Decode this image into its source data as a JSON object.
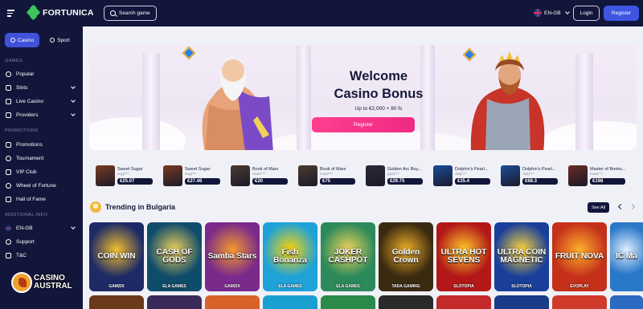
{
  "brand": {
    "name": "FORTUNICA"
  },
  "header": {
    "search_label": "Search game",
    "language": "EN-GB",
    "login": "Login",
    "register": "Register"
  },
  "sidebar": {
    "modes": [
      {
        "label": "Casino"
      },
      {
        "label": "Sport"
      }
    ],
    "sections": {
      "games": "GAMES",
      "promotions": "PROMOTIONS",
      "additional": "ADDITIONAL INFO"
    },
    "games": [
      {
        "label": "Popular"
      },
      {
        "label": "Slots"
      },
      {
        "label": "Live Casino"
      },
      {
        "label": "Providers"
      }
    ],
    "promotions": [
      {
        "label": "Promotions"
      },
      {
        "label": "Tournament"
      },
      {
        "label": "VIP Club"
      },
      {
        "label": "Wheel of Fortune"
      },
      {
        "label": "Hall of Fame"
      }
    ],
    "additional": [
      {
        "label": "EN-GB"
      },
      {
        "label": "Support"
      },
      {
        "label": "T&C"
      }
    ]
  },
  "watermark": {
    "line1": "CASINO",
    "line2": "AUSTRAL"
  },
  "hero": {
    "title_line1": "Welcome",
    "title_line2": "Casino Bonus",
    "subtitle": "Up to €2,000 + 80 fs",
    "cta": "Register"
  },
  "wins": [
    {
      "game": "Sweet Sugar",
      "user": "sugi***",
      "amount": "€25.07",
      "color": "#7a3b20"
    },
    {
      "game": "Sweet Sugar",
      "user": "sugi***",
      "amount": "€27.46",
      "color": "#7a3b20"
    },
    {
      "game": "Book of Marx",
      "user": "marx***",
      "amount": "€20",
      "color": "#4a3a30"
    },
    {
      "game": "Book of Marx",
      "user": "marx***",
      "amount": "€75",
      "color": "#4a3a30"
    },
    {
      "game": "Golden Arc Buy...",
      "user": "gold***",
      "amount": "€29.75",
      "color": "#2a2a38"
    },
    {
      "game": "Dolphin's Pearl...",
      "user": "dolp***",
      "amount": "€25.4",
      "color": "#1c4c9a"
    },
    {
      "game": "Dolphin's Pearl...",
      "user": "dolp***",
      "amount": "€68.3",
      "color": "#1c4c9a"
    },
    {
      "game": "Master of Books...",
      "user": "mast***",
      "amount": "€198",
      "color": "#6a2c24"
    }
  ],
  "trending": {
    "title": "Trending in Bulgaria",
    "see_all": "See All"
  },
  "games": [
    {
      "name": "COIN WIN",
      "provider": "GAMZIX",
      "bg": "#1d2a66",
      "accent": "#f5c02c"
    },
    {
      "name": "CASH OF GODS",
      "provider": "ELA GAMES",
      "bg": "#0f4c6a",
      "accent": "#f3d15a"
    },
    {
      "name": "Samba Stars",
      "provider": "GAMZIX",
      "bg": "#7a2a8a",
      "accent": "#f59a2c"
    },
    {
      "name": "Fish Bonanza",
      "provider": "ELA GAMES",
      "bg": "#1ea2d8",
      "accent": "#ffd400"
    },
    {
      "name": "JOKER CASHPOT",
      "provider": "ELA GAMES",
      "bg": "#2c8a5a",
      "accent": "#f2d45a"
    },
    {
      "name": "Golden Crown",
      "provider": "TADA GAMING",
      "bg": "#3a2a10",
      "accent": "#f2b12a"
    },
    {
      "name": "ULTRA HOT SEVENS",
      "provider": "SLOTOPIA",
      "bg": "#b21818",
      "accent": "#ffce2a"
    },
    {
      "name": "ULTRA COIN MAGNETIC",
      "provider": "SLOTOPIA",
      "bg": "#1a3f9a",
      "accent": "#ffd63a"
    },
    {
      "name": "FRUIT NOVA",
      "provider": "EVOPLAY",
      "bg": "#c4301a",
      "accent": "#ffb02a"
    },
    {
      "name": "IC Ma",
      "provider": "",
      "bg": "#2a78c8",
      "accent": "#dfefff"
    }
  ],
  "games_row2_colors": [
    "#6a3a1a",
    "#3a2a5a",
    "#d8622a",
    "#1aa0d0",
    "#2a8a4a",
    "#2a2a2a",
    "#c42a2a",
    "#1a3a8a",
    "#d03a2a",
    "#2a6ac0"
  ]
}
